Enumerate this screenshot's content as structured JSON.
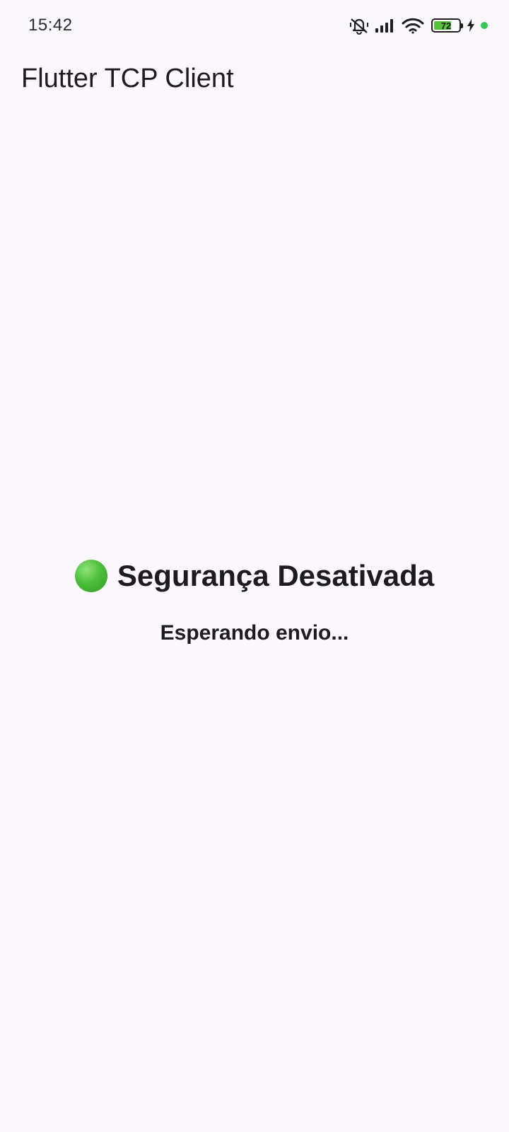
{
  "status_bar": {
    "time": "15:42",
    "battery_level": 72,
    "battery_text": "72",
    "icons": [
      "bell-off-icon",
      "signal-icon",
      "wifi-icon",
      "battery-icon",
      "charging-bolt-icon",
      "privacy-dot-icon"
    ],
    "colors": {
      "battery_fill": "#56c23b",
      "privacy_dot": "#37c75a"
    }
  },
  "app_bar": {
    "title": "Flutter TCP Client"
  },
  "main": {
    "status_icon": "green-circle-icon",
    "status_text": "Segurança Desativada",
    "sub_text": "Esperando envio..."
  },
  "colors": {
    "background": "#fbf8fe",
    "text": "#1d1b20"
  }
}
